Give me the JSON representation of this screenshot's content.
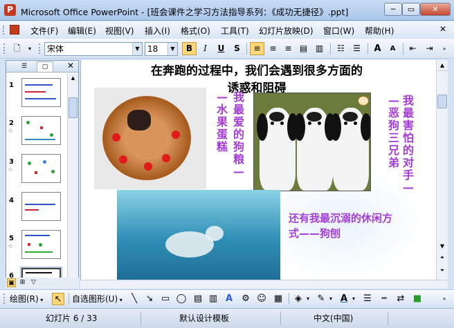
{
  "window": {
    "app_icon": "P",
    "title": "Microsoft Office PowerPoint - [班会课件之学习方法指导系列：《成功无捷径》.ppt]",
    "min_label": "─",
    "max_label": "▭",
    "close_label": "✕"
  },
  "menu": {
    "items": [
      "文件(F)",
      "编辑(E)",
      "视图(V)",
      "插入(I)",
      "格式(O)",
      "工具(T)",
      "幻灯片放映(D)",
      "窗口(W)",
      "帮助(H)"
    ],
    "close_label": "✕"
  },
  "toolbar": {
    "font_name": "宋体",
    "font_size": "18",
    "bold": "B",
    "italic": "I",
    "underline": "U",
    "shadow": "S",
    "increase_font": "A",
    "decrease_font": "A"
  },
  "left_pane": {
    "tab_outline": "☰",
    "tab_slides": "▢",
    "close_label": "✕",
    "slides": [
      {
        "number": "1",
        "star": ""
      },
      {
        "number": "2",
        "star": "☆"
      },
      {
        "number": "3",
        "star": "☆"
      },
      {
        "number": "4",
        "star": ""
      },
      {
        "number": "5",
        "star": "☆"
      },
      {
        "number": "6",
        "star": ""
      }
    ]
  },
  "slide": {
    "heading": "在奔跑的过程中，我们会遇到很多方面的\n诱惑和阻碍",
    "cake_caption": "—水果蛋糕",
    "favorite_caption": "我最爱的狗粮—",
    "fear_caption_1": "—恶狗三兄弟",
    "fear_caption_2": "我最害怕的对手—",
    "hobby_caption": "还有我最沉溺的休闲方式——狗刨"
  },
  "draw_toolbar": {
    "draw_label": "绘图(R)",
    "autoshapes_label": "自选图形(U)"
  },
  "status": {
    "slide_indicator": "幻灯片 6 / 33",
    "template": "默认设计模板",
    "language": "中文(中国)"
  }
}
